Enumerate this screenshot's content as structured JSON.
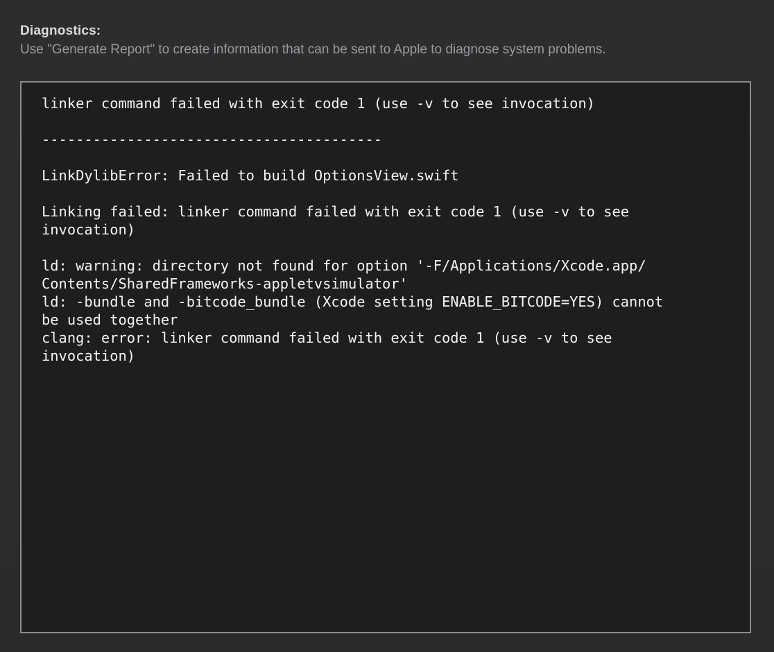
{
  "diagnostics": {
    "title": "Diagnostics:",
    "subtitle": "Use \"Generate Report\" to create information that can be sent to Apple to diagnose system problems.",
    "log": "linker command failed with exit code 1 (use -v to see invocation)\n\n----------------------------------------\n\nLinkDylibError: Failed to build OptionsView.swift\n\nLinking failed: linker command failed with exit code 1 (use -v to see\ninvocation)\n\nld: warning: directory not found for option '-F/Applications/Xcode.app/\nContents/SharedFrameworks-appletvsimulator'\nld: -bundle and -bitcode_bundle (Xcode setting ENABLE_BITCODE=YES) cannot\nbe used together\nclang: error: linker command failed with exit code 1 (use -v to see\ninvocation)"
  }
}
